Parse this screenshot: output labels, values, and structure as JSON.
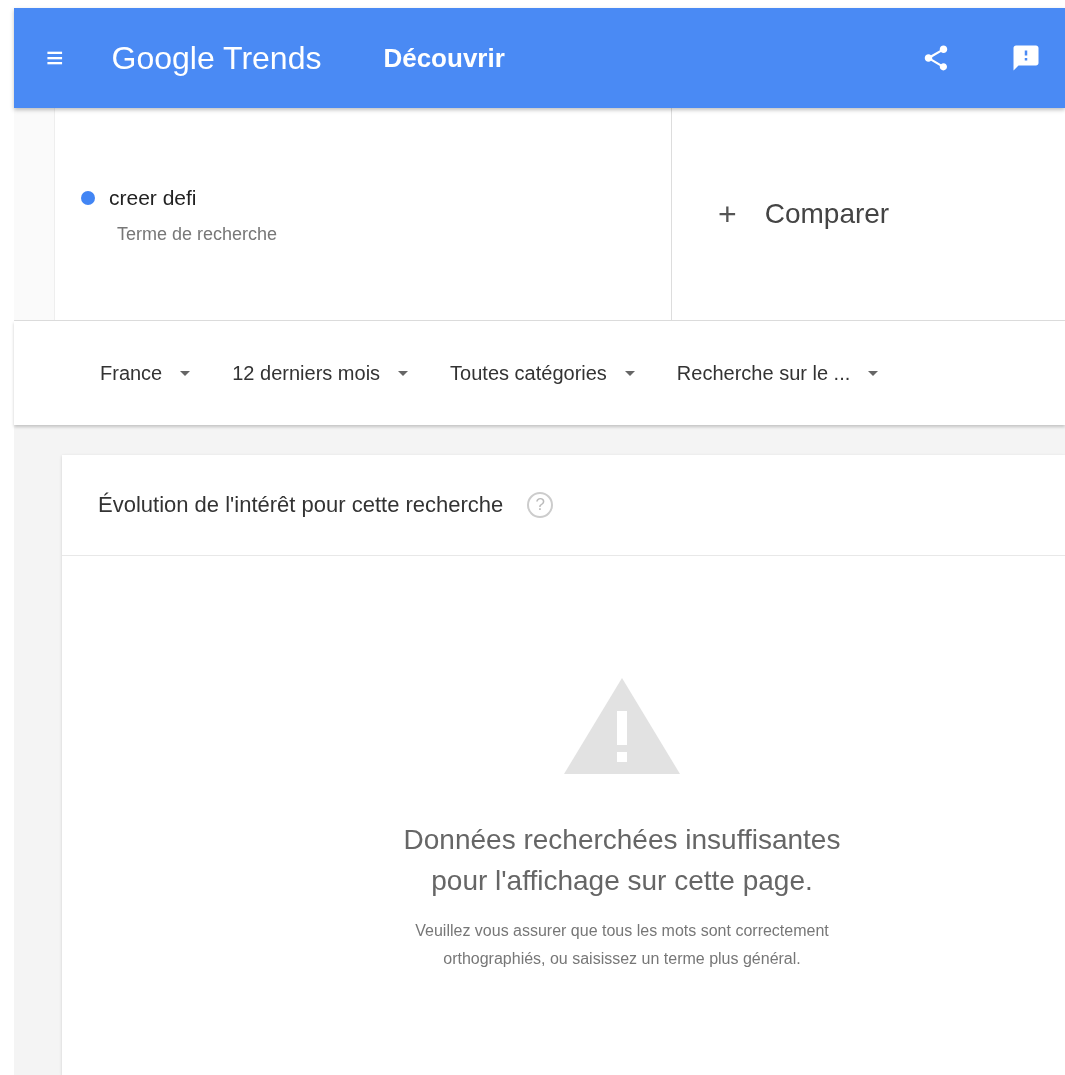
{
  "header": {
    "menu_glyph": "≡",
    "logo": "Google Trends",
    "nav": "Découvrir"
  },
  "terms": [
    {
      "name": "creer defi",
      "subtitle": "Terme de recherche",
      "color": "#4285f4"
    }
  ],
  "compare": {
    "glyph": "+",
    "label": "Comparer"
  },
  "filters": [
    {
      "label": "France"
    },
    {
      "label": "12 derniers mois"
    },
    {
      "label": "Toutes catégories"
    },
    {
      "label": "Recherche sur le ..."
    }
  ],
  "card": {
    "title": "Évolution de l'intérêt pour cette recherche",
    "help_glyph": "?",
    "empty_title": "Données recherchées insuffisantes pour l'affichage sur cette page.",
    "empty_body": "Veuillez vous assurer que tous les mots sont correctement orthographiés, ou saisissez un terme plus général."
  }
}
